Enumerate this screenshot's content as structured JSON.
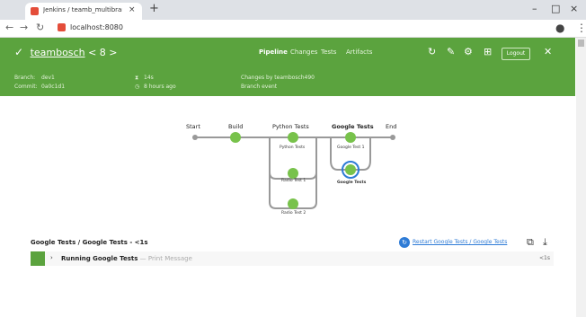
{
  "browser": {
    "tab_title": "Jenkins / teamb_multibranch_pip",
    "tab_close": "×",
    "new_tab": "+",
    "url": "localhost:8080",
    "window_minimize": "–",
    "window_maximize": "□",
    "window_close": "×"
  },
  "header": {
    "project": "teambosch",
    "separator": "<",
    "build_number": "8",
    "chevron": ">",
    "tabs": [
      "Pipeline",
      "Changes",
      "Tests",
      "Artifacts"
    ],
    "logout": "Logout",
    "branch_label": "Branch:",
    "branch_value": "dev1",
    "commit_label": "Commit:",
    "commit_value": "0a0c1d1",
    "duration": "14s",
    "time_ago": "8 hours ago",
    "changes_text": "Changes by teambosch490",
    "trigger_text": "Branch event"
  },
  "pipeline": {
    "stages": [
      "Start",
      "Build",
      "Python Tests",
      "Google Tests",
      "End"
    ],
    "parallel_nodes": [
      "Python Tests",
      "Radio Test 1",
      "Radio Test 2",
      "Google Test 1",
      "Google Tests"
    ]
  },
  "log": {
    "title": "Google Tests / Google Tests - <1s",
    "restart_link": "Restart Google Tests / Google Tests",
    "step_name": "Running Google Tests",
    "step_desc": "— Print Message",
    "step_duration": "<1s"
  },
  "colors": {
    "header_green": "#5ba33e",
    "node_green": "#78c24b",
    "selected_blue": "#2e7bd6"
  }
}
